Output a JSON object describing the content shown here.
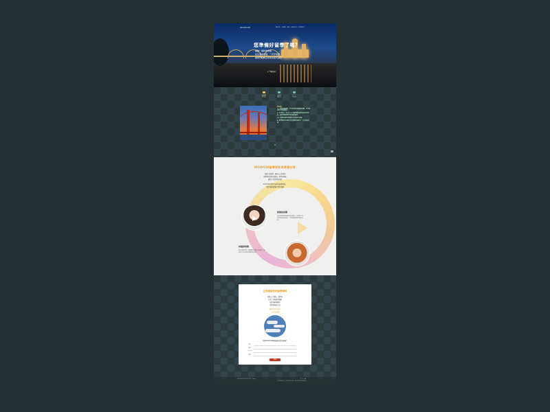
{
  "hero": {
    "logo": "WOWOW",
    "menu": "ABOUT · WHAT · FAQ · SIGN UP · CONTACT",
    "title": "您準備好留學了嗎？",
    "lines": [
      "開始一個新的旅程",
      "在這個城市裡，一步步前進",
      "讓我們陪你完成你的留學夢想"
    ],
    "cta": "▸ 了解更多"
  },
  "tabs": [
    {
      "label": "留學",
      "sub": "STUDY",
      "color": "#e8c05a"
    },
    {
      "label": "遊學",
      "sub": "TRAVEL",
      "color": "#6fc2b0"
    },
    {
      "label": "打工",
      "sub": "WORK",
      "color": "#6fc2b0"
    }
  ],
  "faq": {
    "heading": "FAQ",
    "paragraphs": [
      "Q1. 我想出國留學，但不知道該怎麼開始準備，也不知道要去哪個國家？",
      "A. 不用擔心，WOWOW 的顧問會依照你的需求與預算，協助規劃最適合你的留學路線。",
      "Q2. 出國前需要準備哪些文件與語言成績？",
      "A. 我們會提供完整的文件清單並協助你一步步完成申請。"
    ]
  },
  "testimonials": {
    "heading": "WOWOW留學資訊與學員分享",
    "intro": [
      "每個人的留學，都有自己的故事",
      "聽聽學長姐們怎麼說，他們的經驗",
      "讓你少走很多冤枉路",
      "WOWOW 陪你完成你的留學夢想，",
      "也給你最專業最完整的服務"
    ],
    "people": [
      {
        "name": "蔡佩怡同學",
        "text": "這次的留學經驗讓我成長很多，也認識了來自世界各地的朋友，非常推薦給想出國的大家。"
      },
      {
        "name": "林雅婷同學",
        "text": "從申請到出發，顧問都非常細心的協助，讓我可以安心地完成留學的夢想。"
      }
    ]
  },
  "form": {
    "title": "立刻填寫你的留學資料",
    "lines": [
      "填寫以下資料，我們會",
      "在第一時間與你聯繫",
      "幫你規劃專屬的",
      "留學路線與方案"
    ],
    "highlight": [
      "讓WOWOW陪你",
      "一起完成夢想"
    ],
    "question": "你對WOWOW哪項服務比較有興趣？",
    "fields": [
      "姓名",
      "電話",
      "Email",
      "其他"
    ],
    "submit": "送出"
  },
  "footer": {
    "address": "WOWOW STUDY TOUR · Taipei",
    "copyright": "COPYRIGHT © WOWOW ALL RIGHTS RESERVED",
    "social": "f ◎ ◆"
  }
}
